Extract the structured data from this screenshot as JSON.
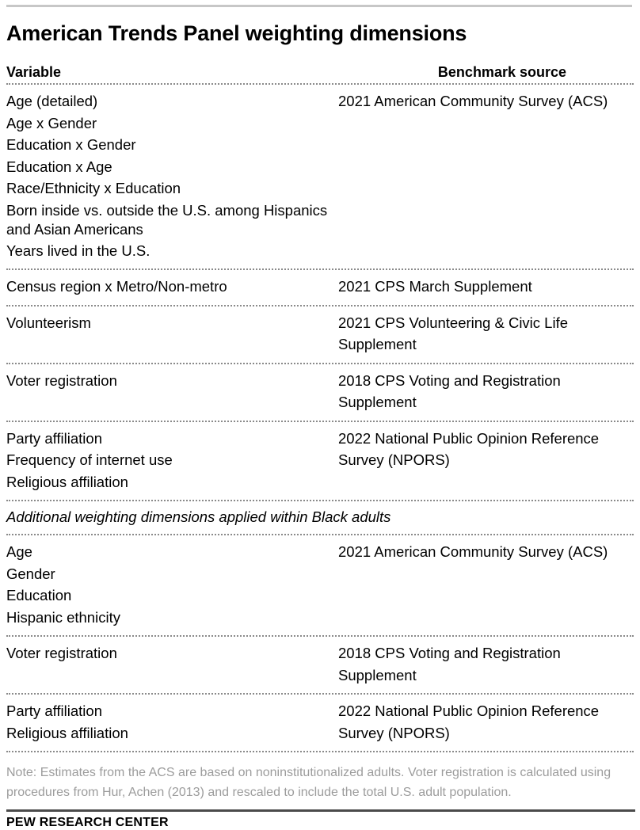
{
  "chart_data": {
    "type": "table",
    "title": "American Trends Panel weighting dimensions",
    "columns": [
      "Variable",
      "Benchmark source"
    ],
    "sections": [
      {
        "kind": "group",
        "variables": [
          "Age (detailed)",
          "Age x Gender",
          "Education x Gender",
          "Education x Age",
          "Race/Ethnicity x Education",
          "Born inside vs. outside the U.S. among Hispanics and Asian Americans",
          "Years lived in the U.S."
        ],
        "source": "2021 American Community Survey (ACS)"
      },
      {
        "kind": "group",
        "variables": [
          "Census region x Metro/Non-metro"
        ],
        "source": "2021 CPS March Supplement"
      },
      {
        "kind": "group",
        "variables": [
          "Volunteerism"
        ],
        "source": "2021 CPS Volunteering & Civic Life Supplement"
      },
      {
        "kind": "group",
        "variables": [
          "Voter registration"
        ],
        "source": "2018 CPS Voting and Registration Supplement"
      },
      {
        "kind": "group",
        "variables": [
          "Party affiliation",
          "Frequency of internet use",
          "Religious affiliation"
        ],
        "source": "2022 National Public Opinion Reference Survey (NPORS)"
      },
      {
        "kind": "subheading",
        "label": "Additional weighting dimensions applied within Black adults"
      },
      {
        "kind": "group",
        "variables": [
          "Age",
          "Gender",
          "Education",
          "Hispanic ethnicity"
        ],
        "source": "2021 American Community Survey (ACS)"
      },
      {
        "kind": "group",
        "variables": [
          "Voter registration"
        ],
        "source": "2018 CPS Voting and Registration Supplement"
      },
      {
        "kind": "group",
        "variables": [
          "Party affiliation",
          "Religious affiliation"
        ],
        "source": "2022 National Public Opinion Reference Survey (NPORS)"
      }
    ]
  },
  "title": "American Trends Panel weighting dimensions",
  "header": {
    "variable": "Variable",
    "benchmark_source": "Benchmark source"
  },
  "rows": {
    "g1": {
      "v1": "Age (detailed)",
      "v2": "Age x Gender",
      "v3": "Education x Gender",
      "v4": "Education x Age",
      "v5": "Race/Ethnicity x Education",
      "v6": "Born inside vs. outside the U.S. among Hispanics and Asian Americans",
      "v7": "Years lived in the U.S.",
      "source": "2021 American Community Survey (ACS)"
    },
    "g2": {
      "v1": "Census region x Metro/Non-metro",
      "source": "2021 CPS March Supplement"
    },
    "g3": {
      "v1": "Volunteerism",
      "source": "2021 CPS Volunteering & Civic Life Supplement"
    },
    "g4": {
      "v1": "Voter registration",
      "source": "2018 CPS Voting and Registration Supplement"
    },
    "g5": {
      "v1": "Party affiliation",
      "v2": "Frequency of internet use",
      "v3": "Religious affiliation",
      "source": "2022 National Public Opinion Reference Survey (NPORS)"
    },
    "subheading": "Additional weighting dimensions applied within Black adults",
    "g6": {
      "v1": "Age",
      "v2": "Gender",
      "v3": "Education",
      "v4": "Hispanic ethnicity",
      "source": "2021 American Community Survey (ACS)"
    },
    "g7": {
      "v1": "Voter registration",
      "source": "2018 CPS Voting and Registration Supplement"
    },
    "g8": {
      "v1": "Party affiliation",
      "v2": "Religious affiliation",
      "source": "2022 National Public Opinion Reference Survey (NPORS)"
    }
  },
  "footer": {
    "note": "Note: Estimates from the ACS are based on noninstitutionalized adults. Voter registration is calculated using procedures from Hur, Achen (2013) and rescaled to include the total U.S. adult population.",
    "brand": "PEW RESEARCH CENTER"
  },
  "colors": {
    "top_rule": "#c7c7c7",
    "bottom_rule": "#4a4a4a",
    "separator": "#8a8a8a",
    "note_text": "#9c9c9c",
    "body_text": "#000000"
  }
}
